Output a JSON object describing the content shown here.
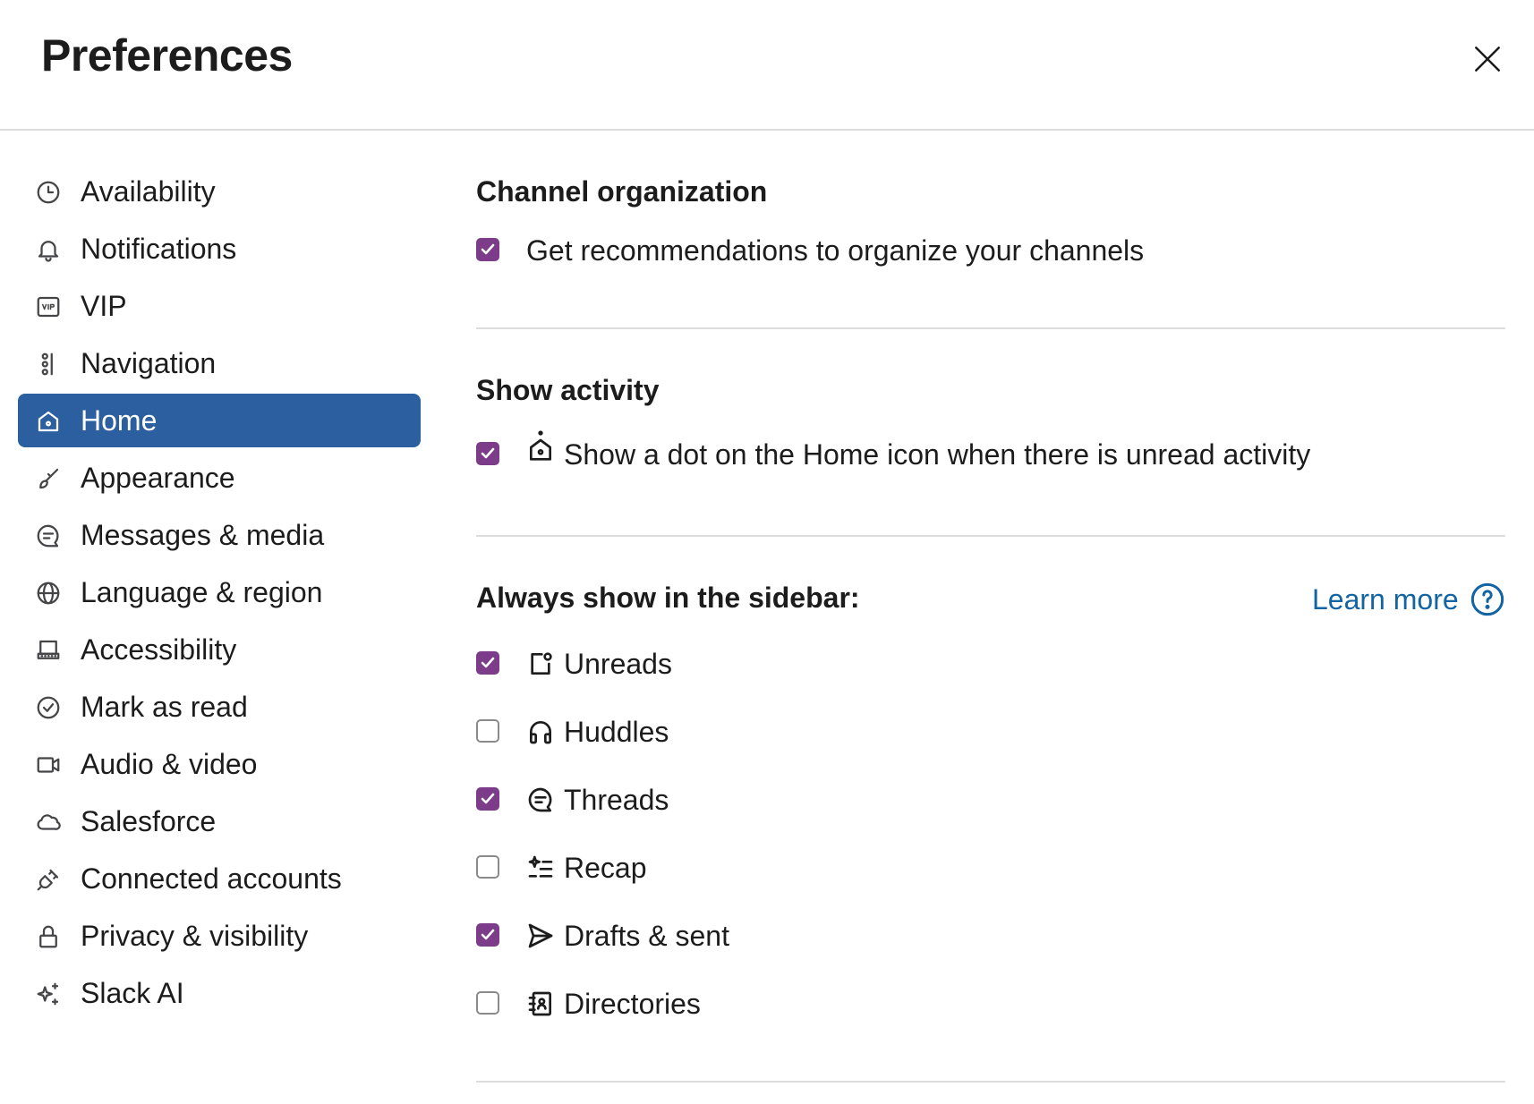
{
  "header": {
    "title": "Preferences",
    "close_icon": "close-icon"
  },
  "sidebar": {
    "items": [
      {
        "label": "Availability",
        "icon": "clock-icon"
      },
      {
        "label": "Notifications",
        "icon": "bell-icon"
      },
      {
        "label": "VIP",
        "icon": "vip-icon"
      },
      {
        "label": "Navigation",
        "icon": "navigation-icon"
      },
      {
        "label": "Home",
        "icon": "home-icon",
        "active": true
      },
      {
        "label": "Appearance",
        "icon": "brush-icon"
      },
      {
        "label": "Messages & media",
        "icon": "message-icon"
      },
      {
        "label": "Language & region",
        "icon": "globe-icon"
      },
      {
        "label": "Accessibility",
        "icon": "keyboard-icon"
      },
      {
        "label": "Mark as read",
        "icon": "check-circle-icon"
      },
      {
        "label": "Audio & video",
        "icon": "video-icon"
      },
      {
        "label": "Salesforce",
        "icon": "cloud-icon"
      },
      {
        "label": "Connected accounts",
        "icon": "plug-icon"
      },
      {
        "label": "Privacy & visibility",
        "icon": "lock-icon"
      },
      {
        "label": "Slack AI",
        "icon": "sparkle-icon"
      }
    ]
  },
  "main": {
    "channel_organization": {
      "title": "Channel organization",
      "option": {
        "label": "Get recommendations to organize your channels",
        "checked": true
      }
    },
    "show_activity": {
      "title": "Show activity",
      "option": {
        "label": "Show a dot on the Home icon when there is unread activity",
        "checked": true,
        "icon": "home-dot-icon"
      }
    },
    "sidebar_section": {
      "title": "Always show in the sidebar:",
      "learn_more": "Learn more",
      "help_icon": "help-circle-icon",
      "options": [
        {
          "label": "Unreads",
          "checked": true,
          "icon": "unreads-icon"
        },
        {
          "label": "Huddles",
          "checked": false,
          "icon": "headphones-icon"
        },
        {
          "label": "Threads",
          "checked": true,
          "icon": "threads-icon"
        },
        {
          "label": "Recap",
          "checked": false,
          "icon": "recap-icon"
        },
        {
          "label": "Drafts & sent",
          "checked": true,
          "icon": "send-icon"
        },
        {
          "label": "Directories",
          "checked": false,
          "icon": "directory-icon"
        }
      ]
    }
  },
  "colors": {
    "accent_selected": "#2c5fa0",
    "checkbox_checked": "#7c3c8a",
    "link": "#1264a3"
  }
}
